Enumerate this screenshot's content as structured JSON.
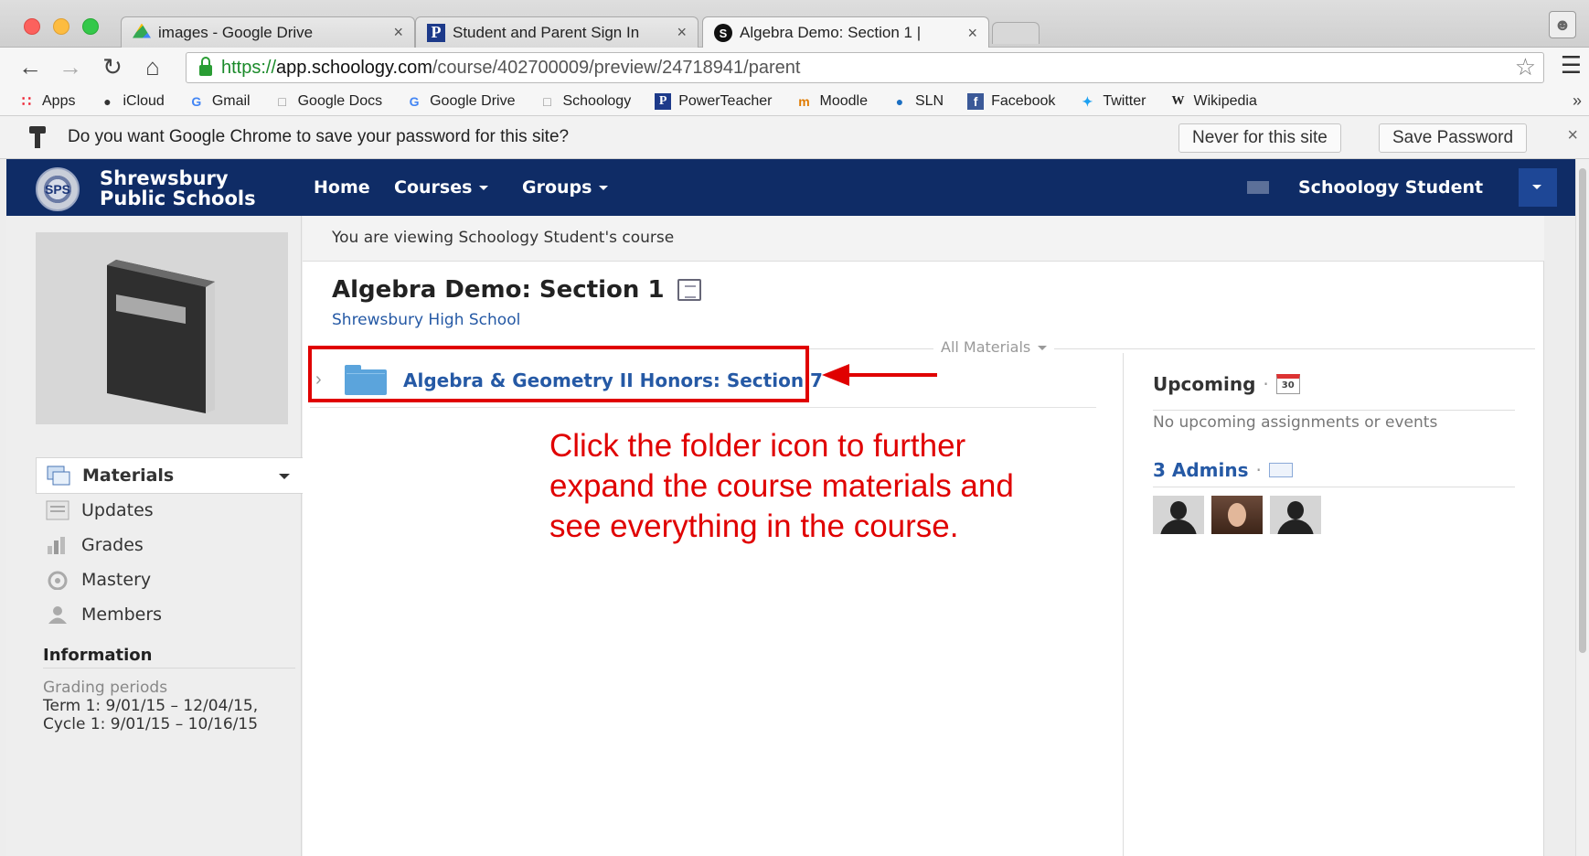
{
  "browser": {
    "tabs": [
      {
        "title": "images - Google Drive",
        "icon": "google-drive-icon"
      },
      {
        "title": "Student and Parent Sign In",
        "icon": "powerteacher-icon"
      },
      {
        "title": "Algebra Demo: Section 1 |",
        "icon": "schoology-icon"
      }
    ],
    "tab_close": "×",
    "url": {
      "scheme": "https://",
      "host": "app.schoology.com",
      "path": "/course/402700009/preview/24718941/parent"
    },
    "bookmarks": [
      {
        "label": "Apps",
        "icon": "apps-grid-icon"
      },
      {
        "label": "iCloud",
        "icon": "apple-icon"
      },
      {
        "label": "Gmail",
        "icon": "google-icon"
      },
      {
        "label": "Google Docs",
        "icon": "page-icon"
      },
      {
        "label": "Google Drive",
        "icon": "google-icon"
      },
      {
        "label": "Schoology",
        "icon": "page-icon"
      },
      {
        "label": "PowerTeacher",
        "icon": "powerteacher-icon"
      },
      {
        "label": "Moodle",
        "icon": "moodle-icon"
      },
      {
        "label": "SLN",
        "icon": "drupal-icon"
      },
      {
        "label": "Facebook",
        "icon": "facebook-icon"
      },
      {
        "label": "Twitter",
        "icon": "twitter-icon"
      },
      {
        "label": "Wikipedia",
        "icon": "wikipedia-icon"
      }
    ],
    "bookmarks_more": "»",
    "infobar": {
      "message": "Do you want Google Chrome to save your password for this site?",
      "never_label": "Never for this site",
      "save_label": "Save Password",
      "close": "×"
    }
  },
  "site": {
    "school_line1": "Shrewsbury",
    "school_line2": "Public Schools",
    "logo_text": "SPS",
    "nav": {
      "home": "Home",
      "courses": "Courses",
      "groups": "Groups"
    },
    "user": "Schoology Student"
  },
  "sidebar": {
    "items": [
      {
        "label": "Materials"
      },
      {
        "label": "Updates"
      },
      {
        "label": "Grades"
      },
      {
        "label": "Mastery"
      },
      {
        "label": "Members"
      }
    ],
    "info_heading": "Information",
    "grading_label": "Grading periods",
    "grading_text": "Term 1: 9/01/15 – 12/04/15, Cycle 1: 9/01/15 – 10/16/15"
  },
  "main": {
    "viewing_notice": "You are viewing Schoology Student's course",
    "course_title": "Algebra Demo: Section 1",
    "school": "Shrewsbury High School",
    "filter": "All Materials",
    "folder": "Algebra & Geometry II Honors: Section 7",
    "annotation": "Click the folder icon to further expand the course materials and see everything in the course."
  },
  "right": {
    "upcoming": "Upcoming",
    "calendar_day": "30",
    "separator": "·",
    "no_upcoming": "No upcoming assignments or events",
    "admins": "3 Admins"
  },
  "colors": {
    "nav_bg": "#0f2c66",
    "link": "#2559a5",
    "annotation": "#e00000"
  }
}
